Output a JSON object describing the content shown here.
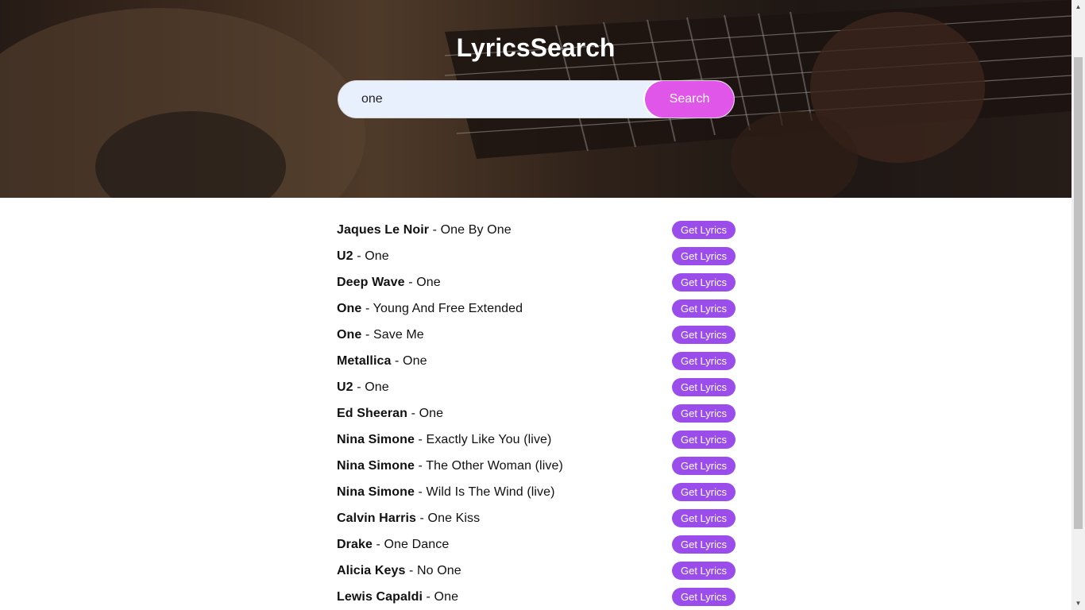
{
  "header": {
    "title": "LyricsSearch"
  },
  "search": {
    "value": "one",
    "button_label": "Search"
  },
  "results": [
    {
      "artist": "Jaques Le Noir",
      "song": "One By One",
      "button_label": "Get Lyrics"
    },
    {
      "artist": "U2",
      "song": "One",
      "button_label": "Get Lyrics"
    },
    {
      "artist": "Deep Wave",
      "song": "One",
      "button_label": "Get Lyrics"
    },
    {
      "artist": "One",
      "song": "Young And Free Extended",
      "button_label": "Get Lyrics"
    },
    {
      "artist": "One",
      "song": "Save Me",
      "button_label": "Get Lyrics"
    },
    {
      "artist": "Metallica",
      "song": "One",
      "button_label": "Get Lyrics"
    },
    {
      "artist": "U2",
      "song": "One",
      "button_label": "Get Lyrics"
    },
    {
      "artist": "Ed Sheeran",
      "song": "One",
      "button_label": "Get Lyrics"
    },
    {
      "artist": "Nina Simone",
      "song": "Exactly Like You (live)",
      "button_label": "Get Lyrics"
    },
    {
      "artist": "Nina Simone",
      "song": "The Other Woman (live)",
      "button_label": "Get Lyrics"
    },
    {
      "artist": "Nina Simone",
      "song": "Wild Is The Wind (live)",
      "button_label": "Get Lyrics"
    },
    {
      "artist": "Calvin Harris",
      "song": "One Kiss",
      "button_label": "Get Lyrics"
    },
    {
      "artist": "Drake",
      "song": "One Dance",
      "button_label": "Get Lyrics"
    },
    {
      "artist": "Alicia Keys",
      "song": "No One",
      "button_label": "Get Lyrics"
    },
    {
      "artist": "Lewis Capaldi",
      "song": "One",
      "button_label": "Get Lyrics"
    }
  ],
  "separator": " - ",
  "colors": {
    "search_button": "#e056e8",
    "lyrics_button": "#9b4deb",
    "input_background": "#e8f0fe"
  },
  "icons": {
    "scroll_up": "scroll-up-arrow-icon",
    "scroll_down": "scroll-down-arrow-icon"
  }
}
